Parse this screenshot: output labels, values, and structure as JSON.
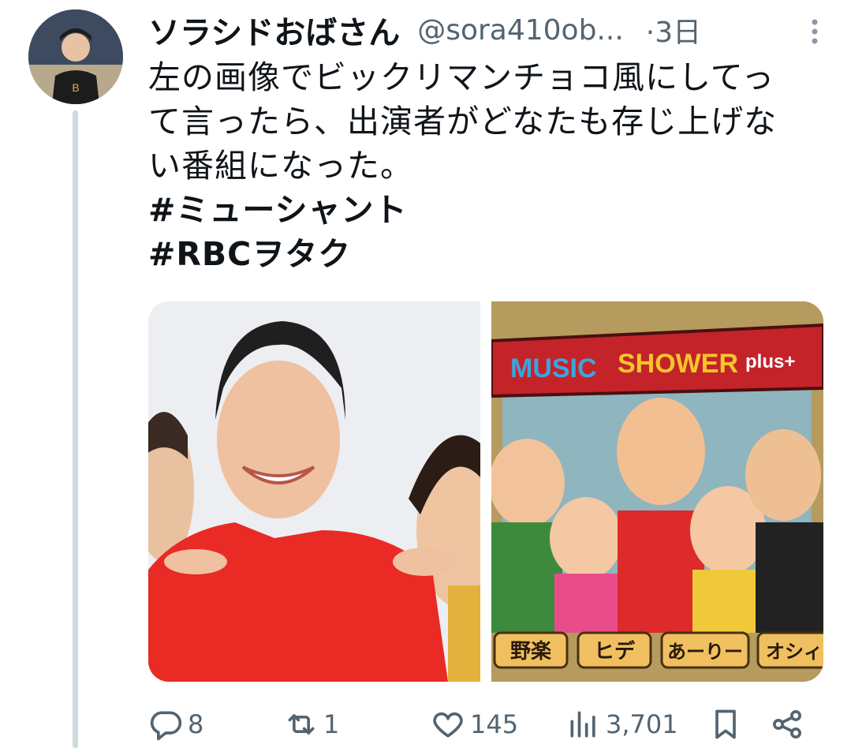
{
  "user": {
    "display_name": "ソラシドおばさん",
    "handle": "@sora410ob...",
    "time": "·3日"
  },
  "tweet": {
    "lines": [
      "左の画像でビックリマンチョコ風にしてっ",
      "て言ったら、出演者がどなたも存じ上げな",
      "い番組になった。"
    ],
    "hashtags": [
      "#ミューシャント",
      "#RBCヲタク"
    ]
  },
  "media": {
    "right_banner": "MUSIC SHOWER plus+",
    "right_banner_parts": [
      "MUSIC",
      "SHOWER",
      "plus+"
    ],
    "right_name_tags": [
      "野楽",
      "ヒデ",
      "あーりー",
      "オシィ"
    ]
  },
  "actions": {
    "reply": {
      "icon": "reply-icon",
      "count": "8"
    },
    "retweet": {
      "icon": "retweet-icon",
      "count": "1"
    },
    "like": {
      "icon": "heart-icon",
      "count": "145"
    },
    "views": {
      "icon": "views-icon",
      "count": "3,701"
    },
    "bookmark": {
      "icon": "bookmark-icon"
    },
    "share": {
      "icon": "share-icon"
    }
  },
  "colors": {
    "text": "#0f1419",
    "secondary": "#536471",
    "thread_line": "#cfd9de"
  }
}
